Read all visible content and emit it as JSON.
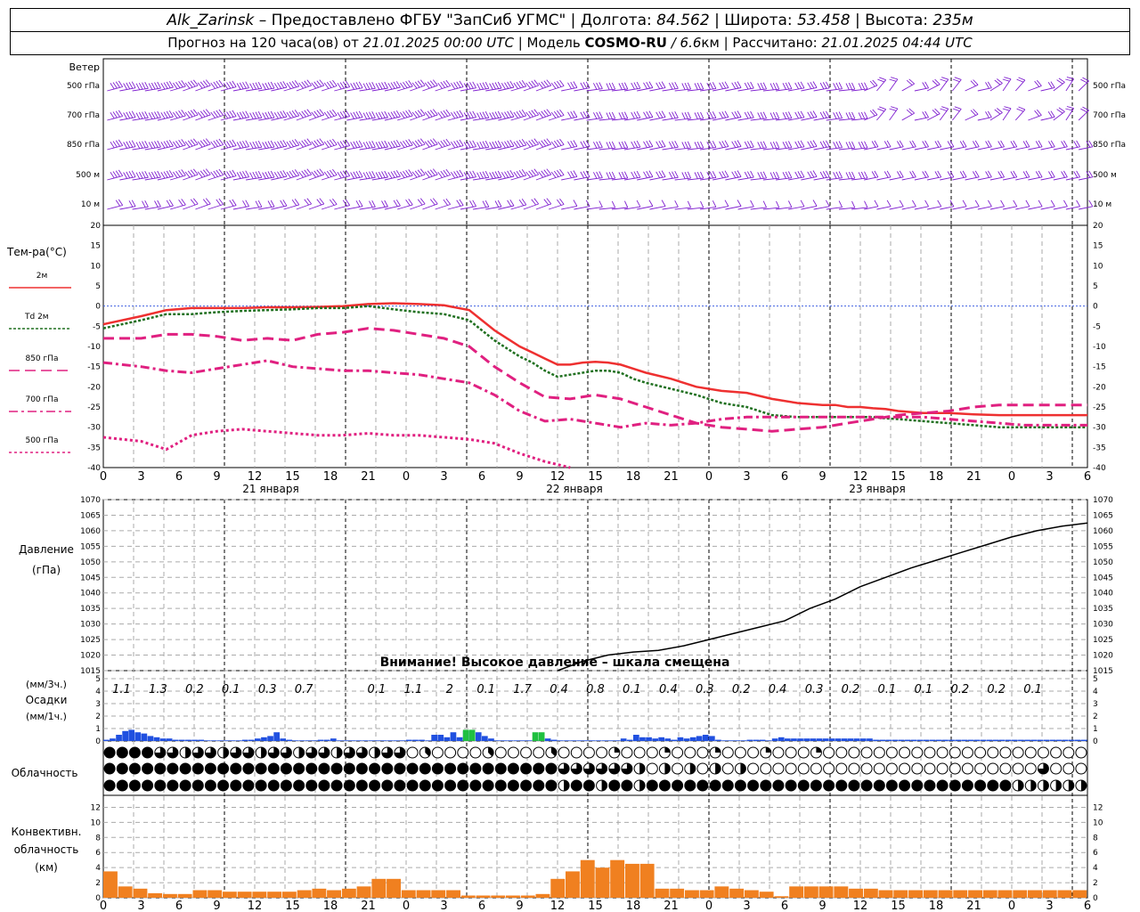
{
  "header": {
    "station": "Alk_Zarinsk",
    "provider": "– Предоставлено ФГБУ \"ЗапСиб УГМС\" |",
    "lon_label": "Долгота:",
    "lon_value": "84.562",
    "lat_label": "| Широта:",
    "lat_value": "53.458",
    "alt_label": "| Высота:",
    "alt_value": "235м",
    "forecast_label": "Прогноз на 120 часа(ов) от",
    "forecast_start": "21.01.2025 00:00 UTC",
    "model_label": "| Модель",
    "model_name": "COSMO-RU",
    "model_res": "/ 6.6",
    "model_res_unit": "км",
    "calc_label": "| Рассчитано:",
    "calc_time": "21.01.2025 04:44 UTC"
  },
  "labels": {
    "wind_title": "Ветер",
    "wind_levels": [
      "500 гПа",
      "700 гПа",
      "850 гПа",
      "500 м",
      "10  м"
    ],
    "temp_title": "Тем-ра(°C)",
    "temp_legend": [
      {
        "name": "2м",
        "color": "#ee3030",
        "dash": ""
      },
      {
        "name": "Td 2м",
        "color": "#207020",
        "dash": "3,2"
      },
      {
        "name": "850 гПа",
        "color": "#e02080",
        "dash": "12,6"
      },
      {
        "name": "700 гПа",
        "color": "#e02080",
        "dash": "10,4,3,4"
      },
      {
        "name": "500 гПа",
        "color": "#e02080",
        "dash": "3,3"
      }
    ],
    "days": [
      "21 января",
      "22 января",
      "23 января"
    ],
    "pressure_title_1": "Давление",
    "pressure_title_2": "(гПа)",
    "pressure_warning": "Внимание! Высокое давление – шкала смещена",
    "precip_unit_3h": "(мм/3ч.)",
    "precip_title": "Осадки",
    "precip_unit_1h": "(мм/1ч.)",
    "cloud_title": "Облачность",
    "conv_title_1": "Конвективн.",
    "conv_title_2": "облачность",
    "conv_title_3": "(км)"
  },
  "chart_data": {
    "x_hours": [
      0,
      3,
      6,
      9,
      12,
      15,
      18,
      21,
      24,
      27,
      30,
      33,
      36,
      39,
      42,
      45,
      48,
      51,
      54,
      57,
      60,
      63,
      66,
      69,
      72,
      75,
      78,
      81,
      84,
      87,
      90,
      93,
      96,
      99,
      102,
      105,
      108,
      111,
      114,
      117,
      120,
      123,
      126,
      129,
      132,
      135,
      138,
      141,
      144,
      147,
      150,
      153,
      156,
      159,
      162,
      165,
      168,
      171,
      174,
      177,
      180,
      183,
      186,
      189,
      192,
      195,
      198
    ],
    "x_tick_labels": [
      "0",
      "3",
      "6",
      "9",
      "12",
      "15",
      "18",
      "21",
      "0",
      "3",
      "6",
      "9",
      "12",
      "15",
      "18",
      "21",
      "0",
      "3",
      "6",
      "9",
      "12",
      "15",
      "18",
      "21",
      "0",
      "3",
      "6"
    ],
    "temperature": {
      "type": "line",
      "ylim": [
        -40,
        20
      ],
      "yticks": [
        -40,
        -35,
        -30,
        -25,
        -20,
        -15,
        -10,
        -5,
        0,
        5,
        10,
        15,
        20
      ],
      "series": [
        {
          "name": "2м",
          "x": [
            0,
            6,
            10,
            14,
            18,
            22,
            26,
            30,
            34,
            38,
            42,
            46,
            50,
            54,
            58,
            62,
            64,
            66,
            68,
            70,
            72,
            74,
            76,
            78,
            80,
            82,
            84,
            86,
            90,
            94,
            98,
            102,
            106,
            110,
            114,
            116,
            118,
            120,
            122,
            124,
            126,
            130,
            134,
            138,
            142,
            144,
            148,
            152,
            156
          ],
          "y": [
            -4.5,
            -2.5,
            -1,
            -0.5,
            -0.5,
            -0.5,
            -0.3,
            -0.3,
            -0.2,
            0,
            0.5,
            0.7,
            0.5,
            0.2,
            -1,
            -6,
            -8,
            -10,
            -11.5,
            -13,
            -14.5,
            -14.5,
            -14,
            -13.8,
            -14,
            -14.5,
            -15.5,
            -16.5,
            -18,
            -20,
            -21,
            -21.5,
            -23,
            -24,
            -24.5,
            -24.5,
            -25,
            -25,
            -25.3,
            -25.5,
            -26,
            -26.5,
            -26.5,
            -26.8,
            -27,
            -27,
            -27,
            -27,
            -27
          ]
        },
        {
          "name": "Td 2м",
          "x": [
            0,
            6,
            10,
            14,
            18,
            22,
            26,
            30,
            34,
            38,
            42,
            46,
            50,
            54,
            58,
            62,
            64,
            66,
            68,
            70,
            72,
            74,
            76,
            78,
            80,
            82,
            84,
            86,
            90,
            94,
            98,
            102,
            106,
            110,
            114,
            116,
            118,
            120,
            122,
            124,
            126,
            130,
            134,
            138,
            142,
            144,
            148,
            152,
            156
          ],
          "y": [
            -5.5,
            -3.5,
            -2,
            -2,
            -1.5,
            -1.2,
            -1,
            -0.8,
            -0.5,
            -0.5,
            0,
            -0.8,
            -1.5,
            -2,
            -3.5,
            -8.5,
            -10.5,
            -12.5,
            -14,
            -16,
            -17.5,
            -17,
            -16.5,
            -16,
            -16,
            -16.5,
            -18,
            -19,
            -20.5,
            -22,
            -24,
            -25,
            -27,
            -27.5,
            -27.5,
            -27.5,
            -27.5,
            -27.5,
            -27.5,
            -27.8,
            -28,
            -28.5,
            -29,
            -29.5,
            -30,
            -30,
            -30,
            -30,
            -30
          ]
        },
        {
          "name": "850 гПа",
          "x": [
            0,
            6,
            10,
            14,
            18,
            22,
            26,
            30,
            34,
            38,
            42,
            46,
            50,
            54,
            58,
            62,
            66,
            70,
            74,
            78,
            82,
            86,
            90,
            94,
            98,
            102,
            106,
            110,
            114,
            118,
            122,
            126,
            130,
            134,
            138,
            142,
            146,
            150,
            156
          ],
          "y": [
            -8,
            -8,
            -7,
            -7,
            -7.5,
            -8.5,
            -8,
            -8.5,
            -7,
            -6.5,
            -5.5,
            -6,
            -7,
            -8,
            -10,
            -15,
            -19,
            -22.5,
            -23,
            -22,
            -23,
            -25,
            -27,
            -29,
            -30,
            -30.5,
            -31,
            -30.5,
            -30,
            -29,
            -28,
            -27,
            -26.5,
            -26,
            -25,
            -24.5,
            -24.5,
            -24.5,
            -24.5
          ]
        },
        {
          "name": "700 гПа",
          "x": [
            0,
            6,
            10,
            14,
            18,
            22,
            26,
            30,
            34,
            38,
            42,
            46,
            50,
            54,
            58,
            62,
            66,
            70,
            74,
            78,
            82,
            86,
            90,
            94,
            98,
            102,
            106,
            110,
            114,
            118,
            122,
            126,
            130,
            134,
            138,
            142,
            146,
            150,
            156
          ],
          "y": [
            -14,
            -15,
            -16,
            -16.5,
            -15.5,
            -14.5,
            -13.5,
            -15,
            -15.5,
            -16,
            -16,
            -16.5,
            -17,
            -18,
            -19,
            -22,
            -26,
            -28.5,
            -28,
            -29,
            -30,
            -29,
            -29.5,
            -29,
            -28,
            -27.5,
            -27.5,
            -27.5,
            -27.5,
            -27.5,
            -27.5,
            -27.5,
            -27.5,
            -28,
            -28.5,
            -29,
            -29.5,
            -29.5,
            -29.5
          ]
        },
        {
          "name": "500 гПа",
          "x": [
            0,
            6,
            10,
            14,
            18,
            22,
            26,
            30,
            34,
            38,
            42,
            46,
            50,
            54,
            58,
            62,
            66,
            70,
            74
          ],
          "y": [
            -32.5,
            -33.5,
            -35.5,
            -32,
            -31,
            -30.5,
            -31,
            -31.5,
            -32,
            -32,
            -31.5,
            -32,
            -32,
            -32.5,
            -33,
            -34,
            -36.5,
            -38.5,
            -40
          ]
        }
      ]
    },
    "pressure": {
      "type": "line",
      "ylim": [
        1015,
        1070
      ],
      "yticks": [
        1015,
        1020,
        1025,
        1030,
        1035,
        1040,
        1045,
        1050,
        1055,
        1060,
        1065,
        1070
      ],
      "series": [
        {
          "name": "Давление",
          "x": [
            72,
            76,
            80,
            84,
            88,
            92,
            96,
            100,
            104,
            108,
            112,
            116,
            120,
            124,
            128,
            132,
            136,
            140,
            144,
            148,
            152,
            156
          ],
          "y": [
            1014,
            1018,
            1020,
            1021,
            1021.5,
            1023,
            1025,
            1027,
            1029,
            1031,
            1035,
            1038,
            1042,
            1045,
            1048,
            1050.5,
            1053,
            1055.5,
            1058,
            1060,
            1061.5,
            1062.5
          ]
        }
      ]
    },
    "precipitation": {
      "type": "bar",
      "ylim": [
        0,
        5
      ],
      "yticks": [
        0,
        1,
        2,
        3,
        4,
        5
      ],
      "sum3h_labels": [
        "1.1",
        "1.3",
        "0.2",
        "0.1",
        "0.3",
        "0.7",
        "",
        "0.1",
        "1.1",
        "2",
        "0.1",
        "1.7",
        "0.4",
        "0.8",
        "0.1",
        "0.4",
        "0.3",
        "0.2",
        "0.4",
        "0.3",
        "0.2",
        "0.1",
        "0.1",
        "0.2",
        "0.2",
        "0.1"
      ],
      "series": [
        {
          "name": "осадки",
          "color": "#2050e0",
          "x": [
            0,
            1,
            2,
            3,
            4,
            5,
            6,
            7,
            8,
            9,
            10,
            11,
            12,
            13,
            14,
            15,
            16,
            17,
            18,
            19,
            20,
            21,
            22,
            23,
            24,
            25,
            26,
            27,
            28,
            29,
            30,
            31,
            32,
            33,
            34,
            35,
            36,
            37,
            38,
            39,
            40,
            41,
            42,
            43,
            44,
            45,
            46,
            47,
            48,
            49,
            50,
            51,
            52,
            53,
            54,
            55,
            56,
            57,
            58,
            59,
            60,
            61,
            62,
            63,
            64,
            65,
            66,
            67,
            68,
            69,
            70,
            71,
            72,
            73,
            74,
            75,
            76,
            77,
            78,
            79,
            80,
            81,
            82,
            83,
            84,
            85,
            86,
            87,
            88,
            89,
            90,
            91,
            92,
            93,
            94,
            95,
            96,
            97,
            98,
            99,
            100,
            101,
            102,
            103,
            104,
            105,
            106,
            107,
            108,
            109,
            110,
            111,
            112,
            113,
            114,
            115,
            116,
            117,
            118,
            119,
            120,
            121,
            122,
            123,
            124,
            125,
            126,
            127,
            128,
            129,
            130,
            131,
            132,
            133,
            134,
            135,
            136,
            137,
            138,
            139,
            140,
            141,
            142,
            143,
            144,
            145,
            146,
            147,
            148,
            149,
            150,
            151,
            152,
            153,
            154,
            155
          ],
          "y": [
            0.1,
            0.2,
            0.5,
            0.8,
            0.9,
            0.7,
            0.6,
            0.4,
            0.3,
            0.2,
            0.2,
            0.1,
            0.1,
            0.1,
            0.1,
            0.1,
            0.05,
            0.05,
            0.05,
            0.05,
            0.05,
            0.05,
            0.1,
            0.1,
            0.2,
            0.3,
            0.4,
            0.7,
            0.2,
            0.1,
            0.05,
            0.05,
            0.05,
            0.05,
            0.1,
            0.1,
            0.2,
            0.05,
            0.05,
            0.05,
            0.05,
            0.05,
            0.05,
            0.05,
            0.05,
            0.05,
            0.05,
            0.05,
            0.1,
            0.1,
            0.1,
            0.05,
            0.5,
            0.5,
            0.3,
            0.7,
            0.3,
            0.8,
            0.8,
            0.7,
            0.4,
            0.2,
            0.05,
            0.05,
            0.05,
            0.05,
            0.05,
            0.05,
            0.1,
            0.1,
            0.2,
            0.1,
            0.05,
            0.05,
            0.05,
            0.05,
            0.05,
            0.05,
            0.05,
            0.05,
            0.05,
            0.05,
            0.2,
            0.1,
            0.5,
            0.3,
            0.3,
            0.2,
            0.3,
            0.2,
            0.1,
            0.3,
            0.2,
            0.3,
            0.4,
            0.5,
            0.4,
            0.1,
            0.05,
            0.05,
            0.05,
            0.05,
            0.1,
            0.1,
            0.1,
            0.05,
            0.2,
            0.3,
            0.2,
            0.2,
            0.2,
            0.2,
            0.2,
            0.2,
            0.2,
            0.2,
            0.2,
            0.2,
            0.2,
            0.2,
            0.2,
            0.2,
            0.1,
            0.1,
            0.1,
            0.1,
            0.1,
            0.1,
            0.1,
            0.1,
            0.1,
            0.1,
            0.1,
            0.1,
            0.1,
            0.1,
            0.1,
            0.1,
            0.1,
            0.1,
            0.1,
            0.1,
            0.1,
            0.1,
            0.1,
            0.1,
            0.1,
            0.1,
            0.1,
            0.1,
            0.1,
            0.1,
            0.1,
            0.1,
            0.1,
            0.1,
            0.1,
            0.1,
            0.1,
            0.1,
            0.1,
            0.1,
            0.1
          ]
        },
        {
          "name": "снег",
          "color": "#20c040",
          "x": [
            57,
            58,
            68,
            69
          ],
          "y": [
            0.9,
            0.9,
            0.7,
            0.7
          ]
        }
      ]
    },
    "convective_clouds": {
      "type": "bar",
      "ylim": [
        0,
        13
      ],
      "yticks": [
        0,
        2,
        4,
        6,
        8,
        10,
        12
      ],
      "color": "#f08020",
      "x": [
        0,
        3,
        6,
        9,
        12,
        15,
        18,
        21,
        24,
        27,
        30,
        33,
        36,
        39,
        42,
        45,
        48,
        51,
        54,
        57,
        60,
        63,
        66,
        69,
        72,
        75,
        78,
        81,
        84,
        87,
        90,
        93,
        96,
        99,
        102,
        105,
        108,
        111,
        114,
        117,
        120,
        123,
        126,
        129,
        132,
        135,
        138,
        141,
        144,
        147,
        150,
        153,
        156,
        159,
        162,
        165,
        168,
        171,
        174,
        177,
        180,
        183,
        186,
        189,
        192,
        195
      ],
      "y": [
        3.5,
        1.5,
        1.2,
        0.6,
        0.5,
        0.5,
        1,
        1,
        0.8,
        0.8,
        0.8,
        0.8,
        0.8,
        1,
        1.2,
        1,
        1.2,
        1.5,
        2.5,
        2.5,
        1,
        1,
        1,
        1,
        0.3,
        0.3,
        0.3,
        0.3,
        0.3,
        0.5,
        2.5,
        3.5,
        5,
        4,
        5,
        4.5,
        4.5,
        1.2,
        1.2,
        1,
        1,
        1.5,
        1.2,
        1,
        0.8,
        0.2,
        1.5,
        1.5,
        1.5,
        1.5,
        1.2,
        1.2,
        1,
        1,
        1,
        1,
        1,
        1,
        1,
        1,
        1,
        1,
        1,
        1,
        1,
        1
      ]
    },
    "cloudiness": {
      "rows": [
        "верхний",
        "средний",
        "нижний"
      ],
      "encoding": "octas 0-8 per 3h step"
    }
  }
}
